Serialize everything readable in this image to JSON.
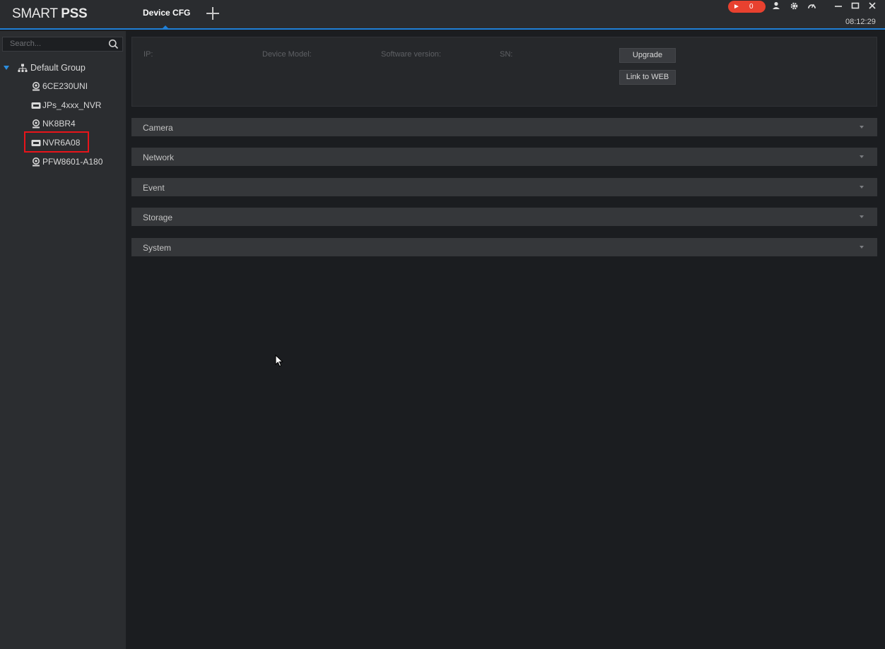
{
  "app": {
    "logo_light": "SMART ",
    "logo_bold": "PSS",
    "clock": "08:12:29"
  },
  "tabs": [
    {
      "label": "Device CFG"
    }
  ],
  "header": {
    "alarm_count": "0"
  },
  "sidebar": {
    "search_placeholder": "Search...",
    "root_label": "Default Group",
    "devices": [
      {
        "label": "6CE230UNI",
        "icon": "camera-icon"
      },
      {
        "label": "JPs_4xxx_NVR",
        "icon": "nvr-icon"
      },
      {
        "label": "NK8BR4",
        "icon": "camera-icon"
      },
      {
        "label": "NVR6A08",
        "icon": "nvr-icon",
        "selected": true
      },
      {
        "label": "PFW8601-A180",
        "icon": "camera-icon"
      }
    ]
  },
  "info": {
    "ip_label": "IP:",
    "model_label": "Device Model:",
    "software_label": "Software version:",
    "sn_label": "SN:",
    "upgrade_button": "Upgrade",
    "link_web_button": "Link to WEB"
  },
  "sections": [
    {
      "label": "Camera"
    },
    {
      "label": "Network"
    },
    {
      "label": "Event"
    },
    {
      "label": "Storage"
    },
    {
      "label": "System"
    }
  ],
  "colors": {
    "accent": "#1f7fd6",
    "alarm": "#e8412f",
    "highlight": "#e8141a"
  }
}
